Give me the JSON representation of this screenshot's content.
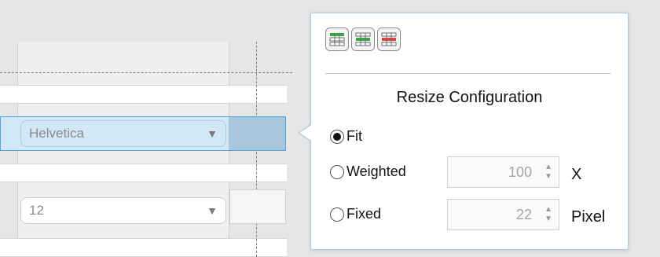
{
  "table": {
    "font_value": "Helvetica",
    "size_value": "12",
    "dropdown_arrow": "▼"
  },
  "popup": {
    "icons": [
      "resize-fit-icon",
      "resize-weighted-icon",
      "resize-fixed-icon"
    ],
    "title": "Resize Configuration",
    "options": {
      "fit": {
        "label": "Fit",
        "selected": true
      },
      "weighted": {
        "label": "Weighted",
        "selected": false,
        "value": "100",
        "unit": "X"
      },
      "fixed": {
        "label": "Fixed",
        "selected": false,
        "value": "22",
        "unit": "Pixel"
      }
    }
  },
  "colors": {
    "selection_bg": "#d3e8f7",
    "selection_border": "#4ea3dc",
    "icon_green": "#3aa648",
    "icon_red": "#e0423a"
  }
}
